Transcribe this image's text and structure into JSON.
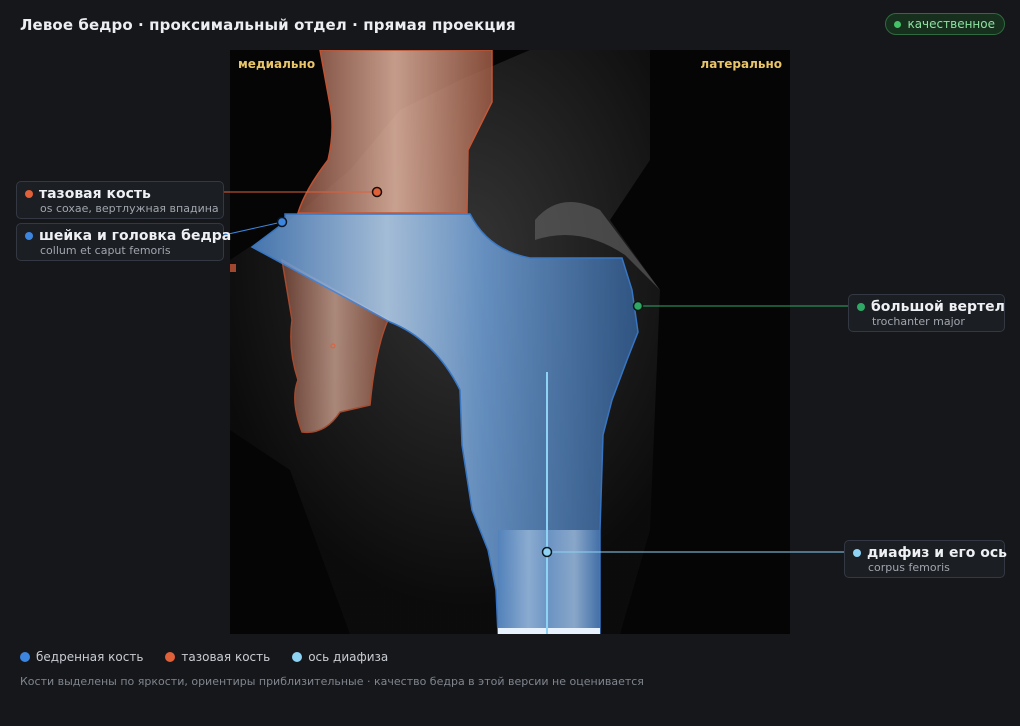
{
  "header": {
    "title": "Левое бедро · проксимальный отдел · прямая проекция",
    "status_badge": "качественное"
  },
  "viewer": {
    "orientation_left": "медиально",
    "orientation_right": "латерально"
  },
  "annotations": [
    {
      "name": "тазовая кость",
      "latin": "os coxae, вертлужная впадина",
      "color": "#e0603a"
    },
    {
      "name": "шейка и головка бедра",
      "latin": "collum et caput femoris",
      "color": "#3d86e0"
    },
    {
      "name": "большой вертел",
      "latin": "trochanter major",
      "color": "#2fa866"
    },
    {
      "name": "диафиз и его ось",
      "latin": "corpus femoris",
      "color": "#8ed2f4"
    }
  ],
  "legend": [
    {
      "label": "бедренная кость",
      "color": "#3d86e0"
    },
    {
      "label": "тазовая кость",
      "color": "#e0603a"
    },
    {
      "label": "ось диафиза",
      "color": "#8ed2f4"
    }
  ],
  "footnote": "Кости выделены по яркости, ориентиры приблизительные · качество бедра в этой версии не оценивается",
  "colors": {
    "background": "#15171b",
    "femur": "#3d86e0",
    "pelvis": "#e0603a",
    "shaft_axis": "#8ed2f4",
    "trochanter": "#2fa866",
    "orientation_text": "#e9c56a",
    "badge_ok": "#43c267"
  }
}
